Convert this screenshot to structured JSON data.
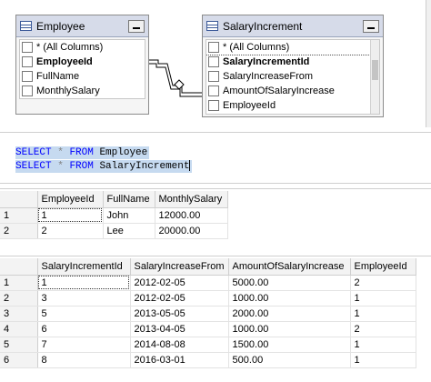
{
  "diagram": {
    "employee": {
      "title": "Employee",
      "columns": [
        {
          "label": "* (All Columns)",
          "bold": false
        },
        {
          "label": "EmployeeId",
          "bold": true
        },
        {
          "label": "FullName",
          "bold": false
        },
        {
          "label": "MonthlySalary",
          "bold": false
        }
      ]
    },
    "salary": {
      "title": "SalaryIncrement",
      "columns": [
        {
          "label": "* (All Columns)",
          "bold": false
        },
        {
          "label": "SalaryIncrementId",
          "bold": true
        },
        {
          "label": "SalaryIncreaseFrom",
          "bold": false
        },
        {
          "label": "AmountOfSalaryIncrease",
          "bold": false
        },
        {
          "label": "EmployeeId",
          "bold": false
        }
      ]
    }
  },
  "sql": {
    "line1": {
      "kw1": "SELECT",
      "star": "*",
      "kw2": "FROM",
      "table": "Employee"
    },
    "line2": {
      "kw1": "SELECT",
      "star": "*",
      "kw2": "FROM",
      "table": "SalaryIncrement"
    }
  },
  "results1": {
    "headers": [
      "",
      "EmployeeId",
      "FullName",
      "MonthlySalary"
    ],
    "rows": [
      [
        "1",
        "1",
        "John",
        "12000.00"
      ],
      [
        "2",
        "2",
        "Lee",
        "20000.00"
      ]
    ]
  },
  "results2": {
    "headers": [
      "",
      "SalaryIncrementId",
      "SalaryIncreaseFrom",
      "AmountOfSalaryIncrease",
      "EmployeeId"
    ],
    "rows": [
      [
        "1",
        "1",
        "2012-02-05",
        "5000.00",
        "2"
      ],
      [
        "2",
        "3",
        "2012-02-05",
        "1000.00",
        "1"
      ],
      [
        "3",
        "5",
        "2013-05-05",
        "2000.00",
        "1"
      ],
      [
        "4",
        "6",
        "2013-04-05",
        "1000.00",
        "2"
      ],
      [
        "5",
        "7",
        "2014-08-08",
        "1500.00",
        "1"
      ],
      [
        "6",
        "8",
        "2016-03-01",
        "500.00",
        "1"
      ]
    ]
  }
}
